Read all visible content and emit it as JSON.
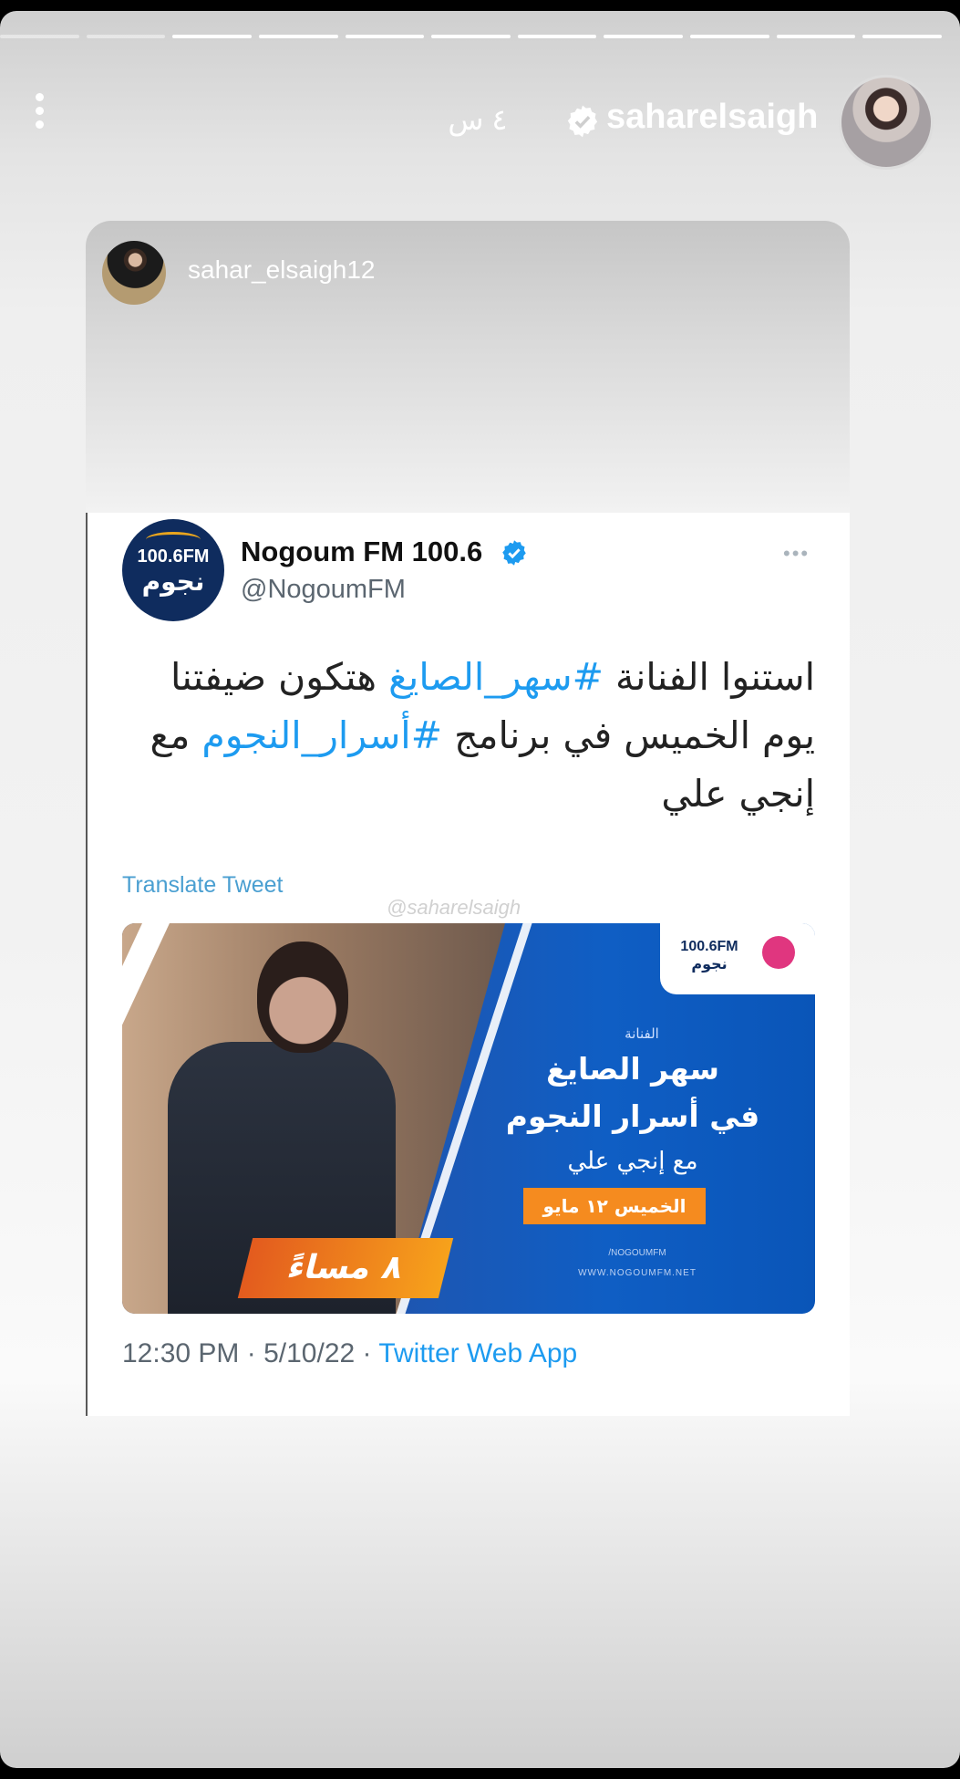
{
  "story": {
    "username": "saharelsaigh",
    "time_ago": "٤ س",
    "segments": 11,
    "active_segment": 2
  },
  "post": {
    "username": "sahar_elsaigh12"
  },
  "tweet": {
    "name": "Nogoum FM 100.6",
    "handle": "@NogoumFM",
    "more_icon": "more-horizontal-icon",
    "text_lines": [
      [
        {
          "t": "استنوا الفنانة ",
          "h": false
        },
        {
          "t": "#سهر_الصايغ",
          "h": true
        },
        {
          "t": " هتكون ضيفتنا",
          "h": false
        }
      ],
      [
        {
          "t": "يوم الخميس في برنامج ",
          "h": false
        },
        {
          "t": "#أسرار_النجوم",
          "h": true
        },
        {
          "t": " مع",
          "h": false
        }
      ],
      [
        {
          "t": "إنجي علي",
          "h": false
        }
      ]
    ],
    "translate_label": "Translate Tweet",
    "time": "12:30 PM",
    "date": "5/10/22",
    "source": "Twitter Web App",
    "watermark": "@saharelsaigh",
    "logo": {
      "number": "100.6FM",
      "arabic": "نجوم"
    }
  },
  "poster": {
    "small_label": "الفنانة",
    "title_line1": "سهر الصايغ",
    "title_line2": "في أسرار النجوم",
    "title_line3": "مع إنجي علي",
    "date_badge": "الخميس ١٢ مايو",
    "time_badge": "٨ مساءً",
    "social": "/NOGOUMFM",
    "website": "WWW.NOGOUMFM.NET",
    "logo_text": "100.6FM نجوم"
  },
  "colors": {
    "link": "#1d9bf0",
    "poster_blue": "#0f5ec4",
    "badge_orange": "#f58b1f"
  }
}
